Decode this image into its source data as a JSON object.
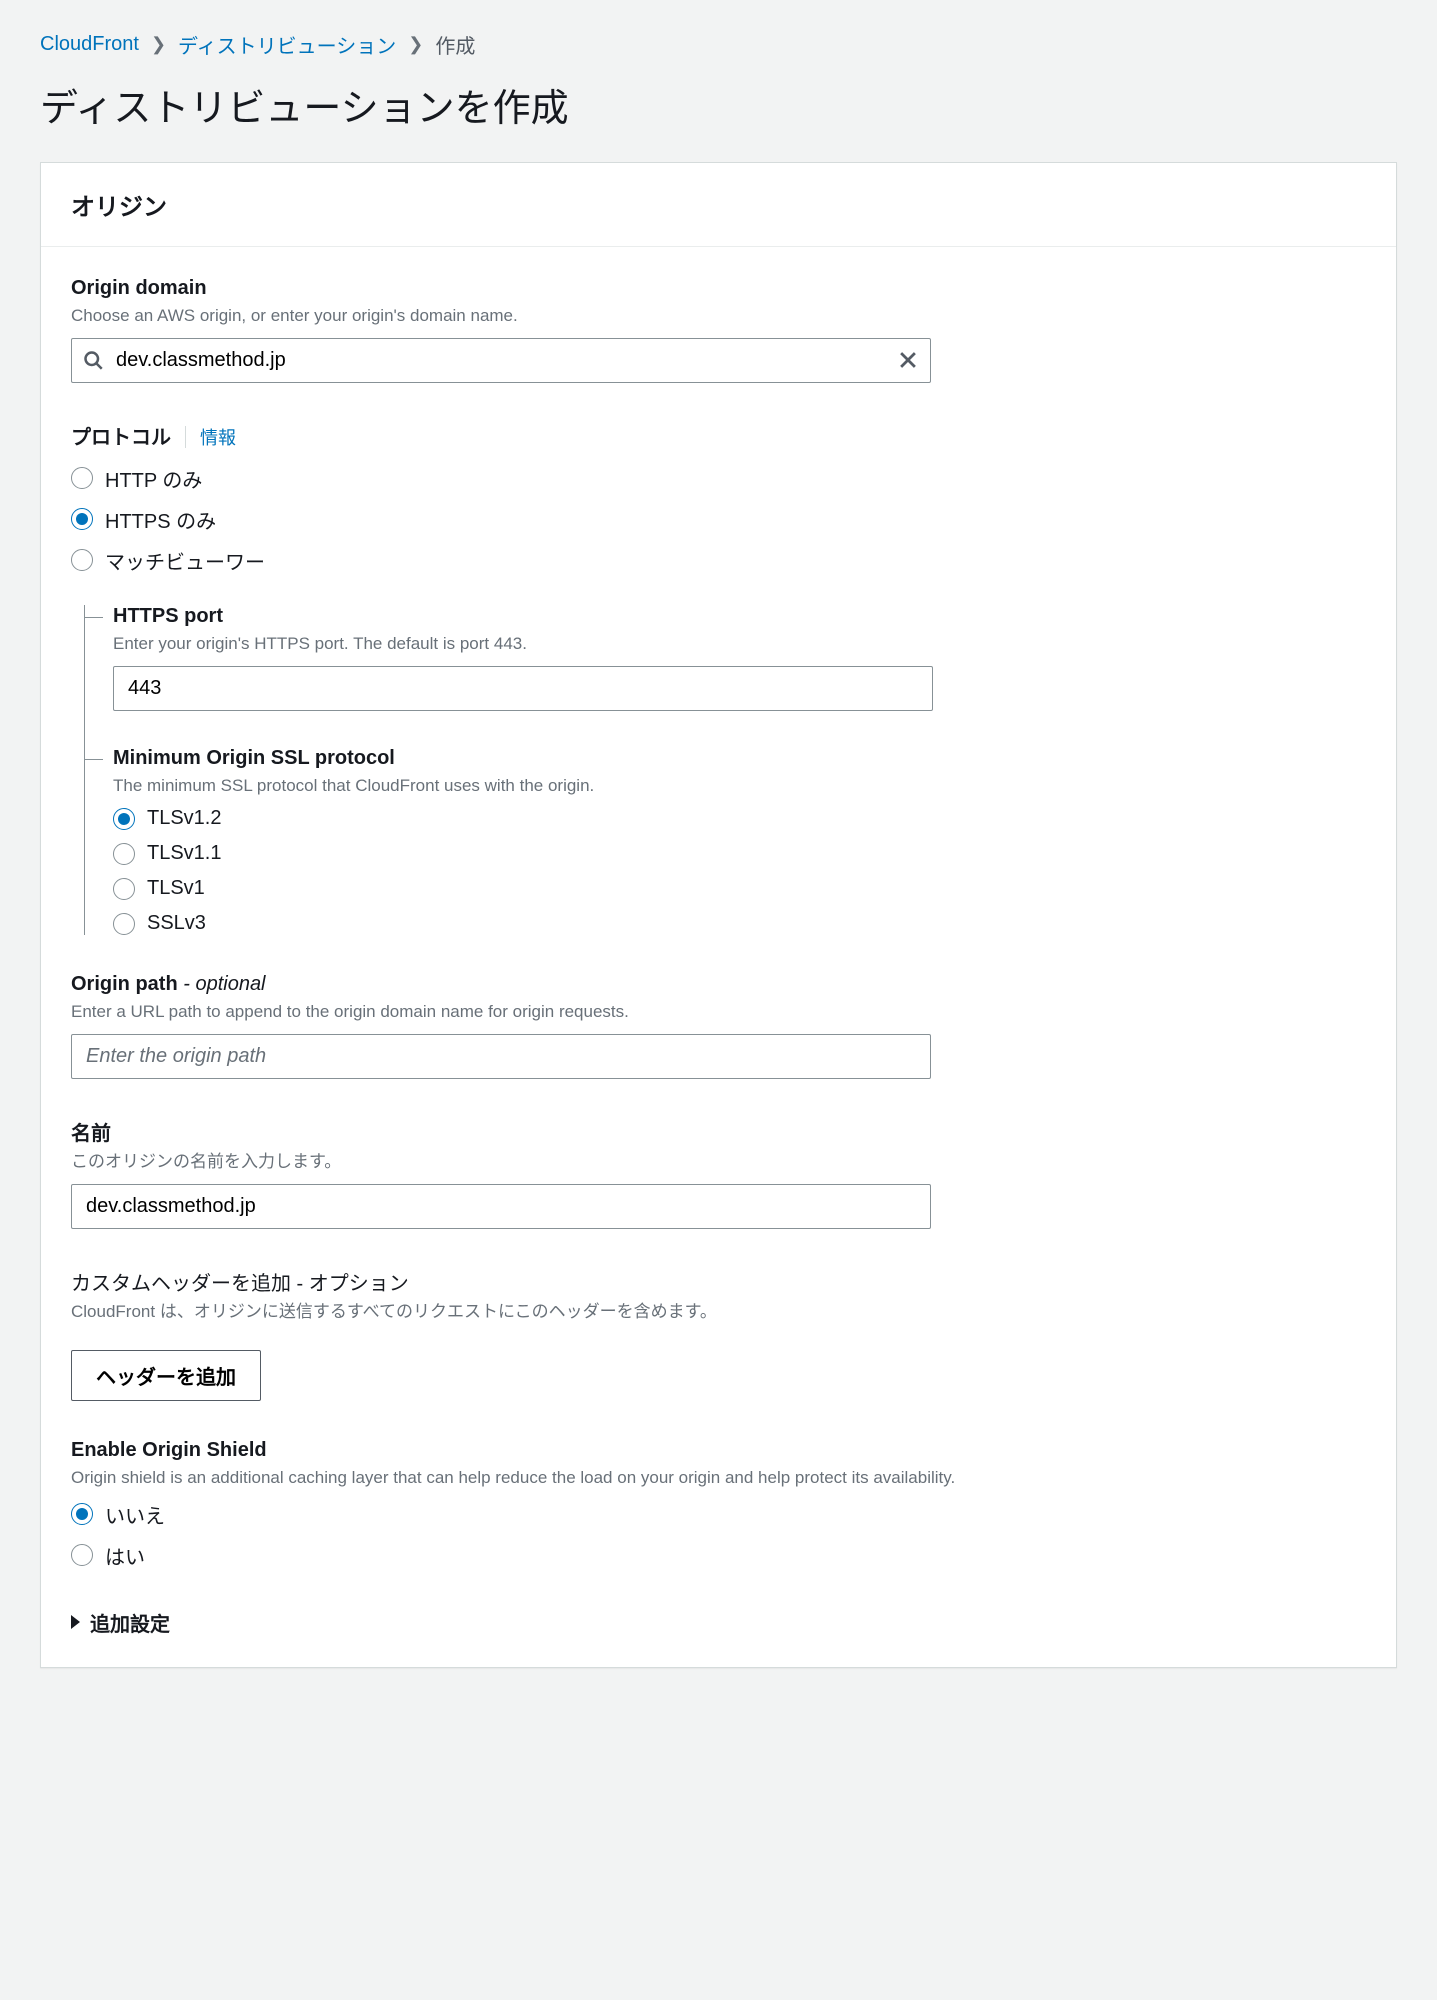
{
  "breadcrumb": {
    "root": "CloudFront",
    "mid": "ディストリビューション",
    "current": "作成"
  },
  "page_title": "ディストリビューションを作成",
  "panel_title": "オリジン",
  "origin_domain": {
    "label": "Origin domain",
    "help": "Choose an AWS origin, or enter your origin's domain name.",
    "value": "dev.classmethod.jp"
  },
  "protocol": {
    "label": "プロトコル",
    "info": "情報",
    "options": [
      "HTTP のみ",
      "HTTPS のみ",
      "マッチビューワー"
    ],
    "selected": "HTTPS のみ"
  },
  "https_port": {
    "label": "HTTPS port",
    "help": "Enter your origin's HTTPS port. The default is port 443.",
    "value": "443"
  },
  "ssl_protocol": {
    "label": "Minimum Origin SSL protocol",
    "help": "The minimum SSL protocol that CloudFront uses with the origin.",
    "options": [
      "TLSv1.2",
      "TLSv1.1",
      "TLSv1",
      "SSLv3"
    ],
    "selected": "TLSv1.2"
  },
  "origin_path": {
    "label": "Origin path",
    "optional": " - optional",
    "help": "Enter a URL path to append to the origin domain name for origin requests.",
    "placeholder": "Enter the origin path",
    "value": ""
  },
  "name": {
    "label": "名前",
    "help": "このオリジンの名前を入力します。",
    "value": "dev.classmethod.jp"
  },
  "custom_header": {
    "label": "カスタムヘッダーを追加 - オプション",
    "help": "CloudFront は、オリジンに送信するすべてのリクエストにこのヘッダーを含めます。",
    "button": "ヘッダーを追加"
  },
  "origin_shield": {
    "label": "Enable Origin Shield",
    "help": "Origin shield is an additional caching layer that can help reduce the load on your origin and help protect its availability.",
    "options": [
      "いいえ",
      "はい"
    ],
    "selected": "いいえ"
  },
  "additional": "追加設定"
}
